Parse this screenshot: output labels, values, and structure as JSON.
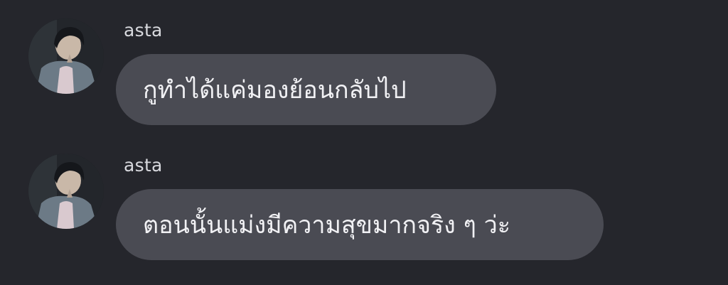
{
  "messages": [
    {
      "sender": "asta",
      "text": "กูทำได้แค่มองย้อนกลับไป"
    },
    {
      "sender": "asta",
      "text": "ตอนนั้นแม่งมีความสุขมากจริง ๆ ว่ะ"
    }
  ],
  "colors": {
    "background": "#25262c",
    "bubble": "#4a4b53",
    "text": "#f1f1f4",
    "sender": "#d8d9de"
  }
}
